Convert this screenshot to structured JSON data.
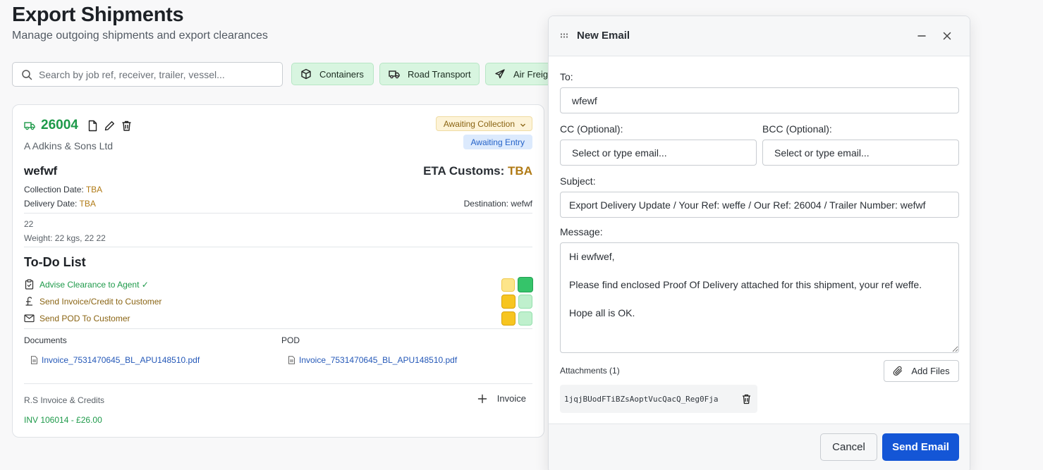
{
  "page": {
    "title": "Export Shipments",
    "subtitle": "Manage outgoing shipments and export clearances"
  },
  "search": {
    "placeholder": "Search by job ref, receiver, trailer, vessel..."
  },
  "filters": [
    {
      "label": "Containers",
      "icon": "box-icon"
    },
    {
      "label": "Road Transport",
      "icon": "truck-icon"
    },
    {
      "label": "Air Freight",
      "icon": "plane-icon"
    }
  ],
  "shipment": {
    "job_number": "26004",
    "receiver": "A Adkins & Sons Ltd",
    "status": "Awaiting Collection",
    "badge": "Awaiting Entry",
    "reference": "wefwf",
    "eta_label": "ETA Customs:",
    "eta_value": "TBA",
    "collection_label": "Collection Date:",
    "collection_value": "TBA",
    "delivery_label": "Delivery Date:",
    "delivery_value": "TBA",
    "destination": "Destination: wefwf",
    "quantity": "22",
    "weight": "Weight: 22 kgs, 22 22",
    "todo_title": "To-Do List",
    "todos": [
      {
        "label": "Advise Clearance to Agent ✓",
        "icon": "clipboard-icon"
      },
      {
        "label": "Send Invoice/Credit to Customer",
        "icon": "pound-icon"
      },
      {
        "label": "Send POD To Customer",
        "icon": "mail-icon"
      }
    ],
    "documents_label": "Documents",
    "documents": [
      "Invoice_7531470645_BL_APU148510.pdf"
    ],
    "pod_label": "POD",
    "pod": [
      "Invoice_7531470645_BL_APU148510.pdf"
    ],
    "invoices_label": "R.S Invoice & Credits",
    "add_invoice_label": "Invoice",
    "invoices": [
      "INV 106014 - £26.00"
    ]
  },
  "colors": {
    "accent_green": "#1e9a4a",
    "amber": "#b07a15",
    "link_blue": "#2458b8",
    "primary_blue": "#1456d6"
  },
  "email": {
    "title": "New Email",
    "to_label": "To:",
    "to_value": "wfewf",
    "cc_label": "CC (Optional):",
    "cc_placeholder": "Select or type email...",
    "bcc_label": "BCC (Optional):",
    "bcc_placeholder": "Select or type email...",
    "subject_label": "Subject:",
    "subject_value": "Export Delivery Update / Your Ref: weffe / Our Ref: 26004 / Trailer Number: wefwf",
    "message_label": "Message:",
    "message_value": "Hi ewfwef,\n\nPlease find enclosed Proof Of Delivery attached for this shipment, your ref weffe.\n\nHope all is OK.",
    "attachments_label": "Attachments (1)",
    "add_files_label": "Add Files",
    "attachment_name": "1jqjBUodFTiBZsAoptVucQacQ_Reg0Fja",
    "cancel_label": "Cancel",
    "send_label": "Send Email"
  }
}
